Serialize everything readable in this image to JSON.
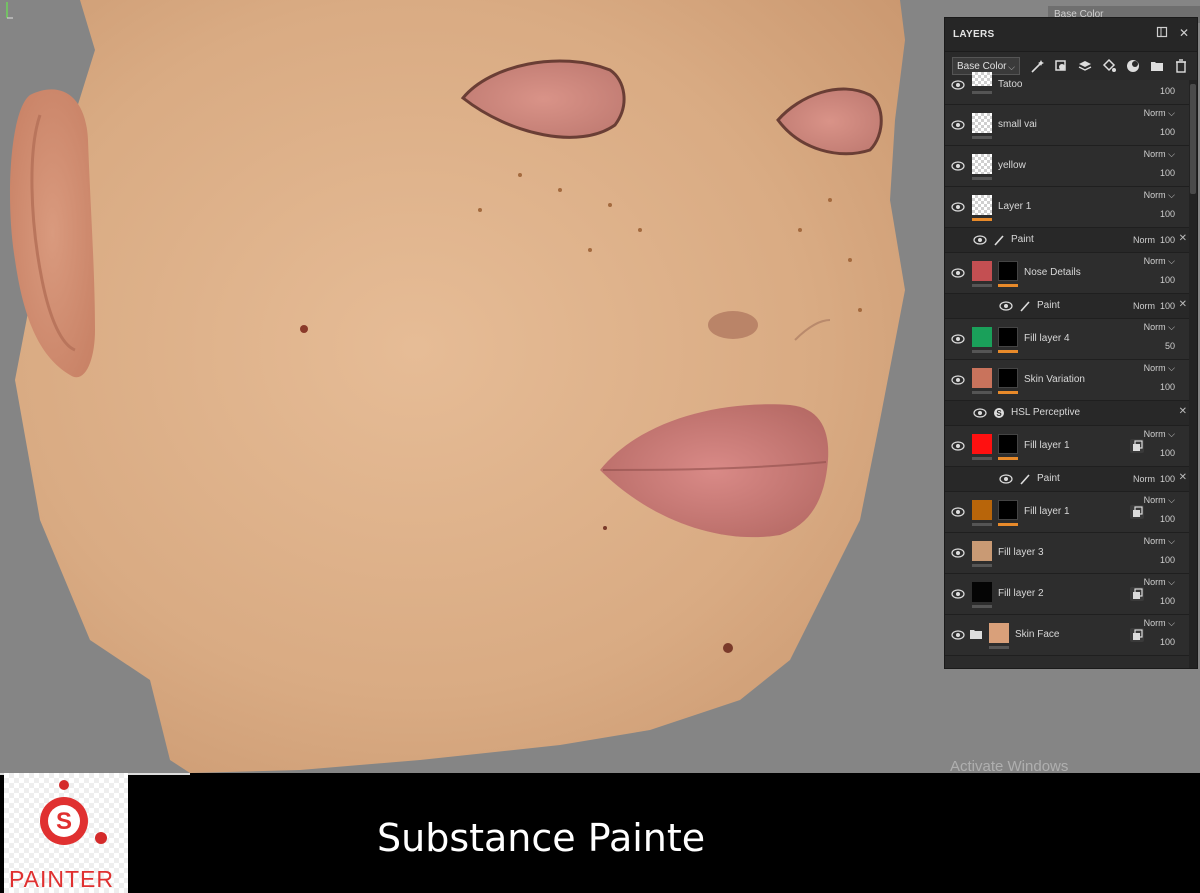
{
  "viewport": {
    "channel_dropdown": "Base Color",
    "watermark": "Activate Windows"
  },
  "layers_panel": {
    "title": "LAYERS",
    "channel": "Base Color",
    "toolbar_icons": [
      "magic-wand-icon",
      "add-smart-material-icon",
      "add-layer-icon",
      "add-fill-layer-icon",
      "add-effect-icon",
      "add-mask-icon",
      "add-folder-icon",
      "trash-icon"
    ],
    "first_row": {
      "name": "Tatoo",
      "opacity": "100"
    },
    "rows": [
      {
        "type": "layer",
        "name": "small vai",
        "thumb": "checker",
        "blend": "Norm",
        "opacity": "100"
      },
      {
        "type": "layer",
        "name": "yellow",
        "thumb": "checker",
        "blend": "Norm",
        "opacity": "100"
      },
      {
        "type": "layer",
        "name": "Layer 1",
        "thumb": "checker",
        "blend": "Norm",
        "opacity": "100"
      },
      {
        "type": "effect",
        "name": "Paint",
        "icon": "brush-icon",
        "blend": "Norm",
        "opacity": "100"
      },
      {
        "type": "layer",
        "name": "Nose Details",
        "thumb": "#c44f52",
        "mask": true,
        "blend": "Norm",
        "opacity": "100"
      },
      {
        "type": "effect",
        "name": "Paint",
        "icon": "brush-icon",
        "blend": "Norm",
        "opacity": "100",
        "indent": true
      },
      {
        "type": "layer",
        "name": "Fill layer 4",
        "thumb": "#1aa05a",
        "mask": true,
        "blend": "Norm",
        "opacity": "50"
      },
      {
        "type": "layer",
        "name": "Skin Variation",
        "thumb": "#c9735c",
        "mask": true,
        "blend": "Norm",
        "opacity": "100"
      },
      {
        "type": "effect",
        "name": "HSL Perceptive",
        "icon": "substance-icon",
        "blend": "",
        "opacity": ""
      },
      {
        "type": "layer",
        "name": "Fill layer 1",
        "thumb": "#ff1010",
        "mask": true,
        "blend": "Norm",
        "opacity": "100",
        "copy": true
      },
      {
        "type": "effect",
        "name": "Paint",
        "icon": "brush-icon",
        "blend": "Norm",
        "opacity": "100",
        "indent": true
      },
      {
        "type": "layer",
        "name": "Fill layer 1",
        "thumb": "#b8650a",
        "mask": true,
        "blend": "Norm",
        "opacity": "100",
        "copy": true
      },
      {
        "type": "layer",
        "name": "Fill layer 3",
        "thumb": "#c99a74",
        "blend": "Norm",
        "opacity": "100"
      },
      {
        "type": "layer",
        "name": "Fill layer 2",
        "thumb": "#050505",
        "blend": "Norm",
        "opacity": "100",
        "copy": true
      },
      {
        "type": "folder",
        "name": "Skin Face",
        "thumb": "#d9a07a",
        "blend": "Norm",
        "opacity": "100",
        "copy": true
      }
    ]
  },
  "banner": {
    "logo_text": "PAINTER",
    "title": "Substance Painte"
  },
  "colors": {
    "panel_bg": "#2b2b2b",
    "accent_orange": "#e88a2a",
    "logo_red": "#e03030",
    "skin": "#dcae86"
  }
}
